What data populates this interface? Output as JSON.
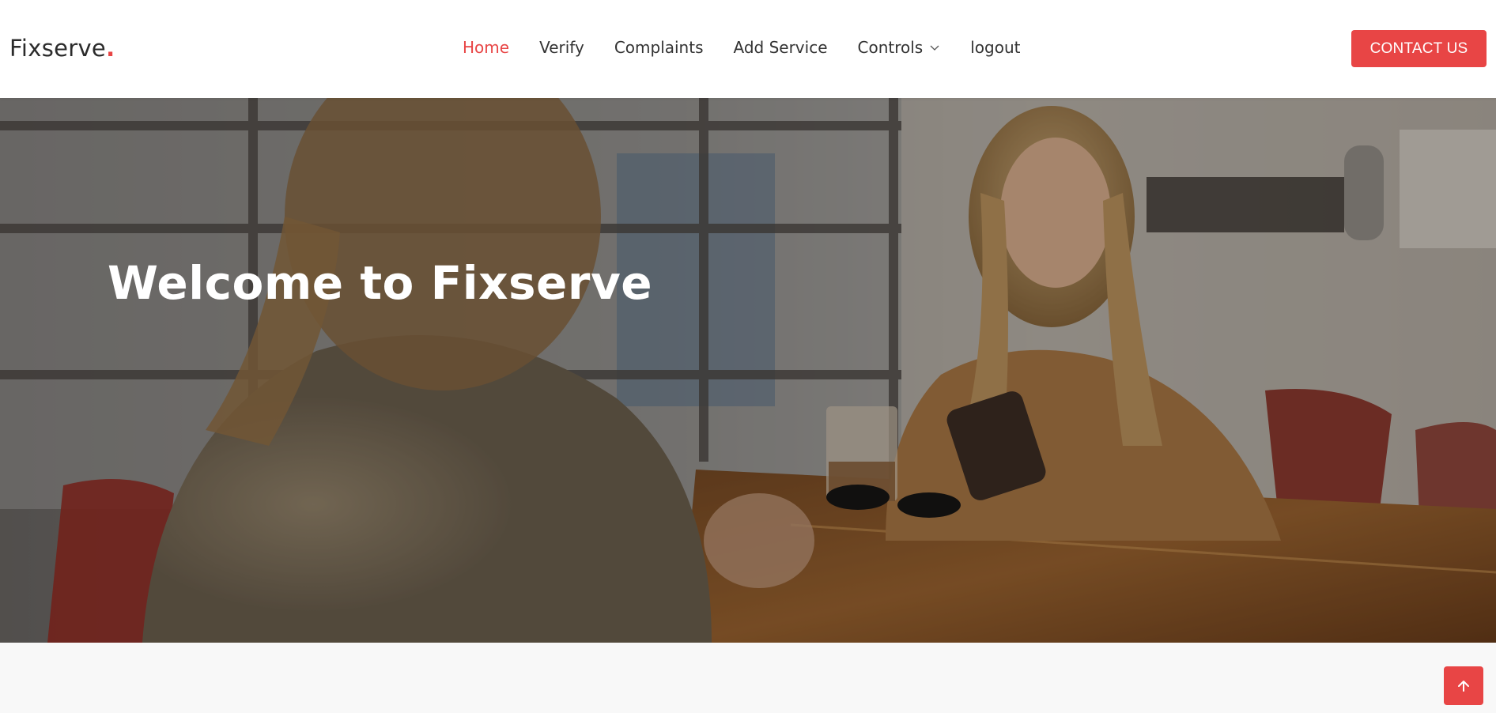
{
  "brand": {
    "name": "Fixserve",
    "dot": ".",
    "accent_color": "#e84545"
  },
  "nav": {
    "items": [
      {
        "label": "Home",
        "active": true
      },
      {
        "label": "Verify",
        "active": false
      },
      {
        "label": "Complaints",
        "active": false
      },
      {
        "label": "Add Service",
        "active": false
      },
      {
        "label": "Controls",
        "active": false,
        "icon": "chevron-down-icon"
      },
      {
        "label": "logout",
        "active": false
      }
    ]
  },
  "header": {
    "contact_label": "CONTACT US"
  },
  "hero": {
    "title": "Welcome to Fixserve",
    "image": "cafe-photo"
  },
  "footer": {
    "back_to_top_icon": "arrow-up-icon"
  }
}
